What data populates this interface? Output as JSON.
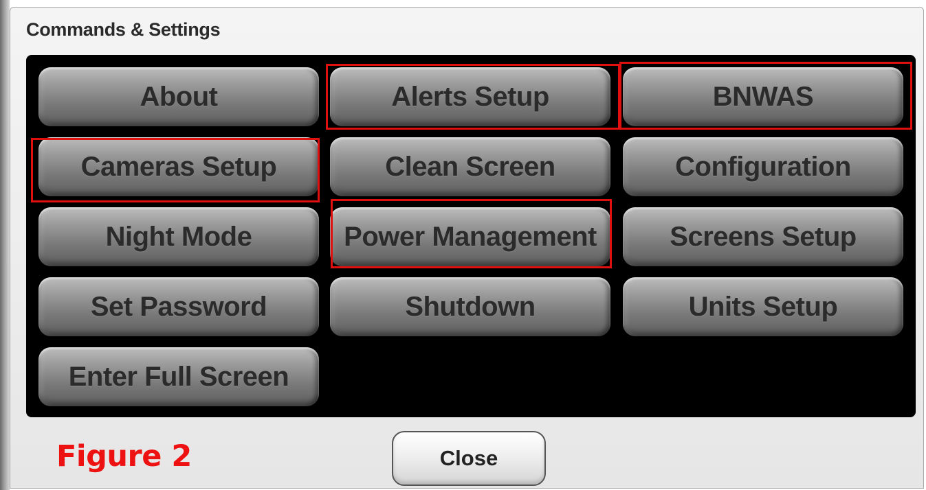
{
  "dialog": {
    "title": "Commands & Settings",
    "close_label": "Close"
  },
  "buttons": {
    "about": "About",
    "alerts_setup": "Alerts Setup",
    "bnwas": "BNWAS",
    "cameras_setup": "Cameras Setup",
    "clean_screen": "Clean Screen",
    "configuration": "Configuration",
    "night_mode": "Night Mode",
    "power_management": "Power Management",
    "screens_setup": "Screens Setup",
    "set_password": "Set Password",
    "shutdown": "Shutdown",
    "units_setup": "Units Setup",
    "enter_full_screen": "Enter Full Screen"
  },
  "annotation": {
    "figure_label": "Figure 2",
    "highlight_color": "#e01010",
    "highlighted_buttons": [
      "Alerts Setup",
      "BNWAS",
      "Cameras Setup",
      "Power Management"
    ]
  }
}
